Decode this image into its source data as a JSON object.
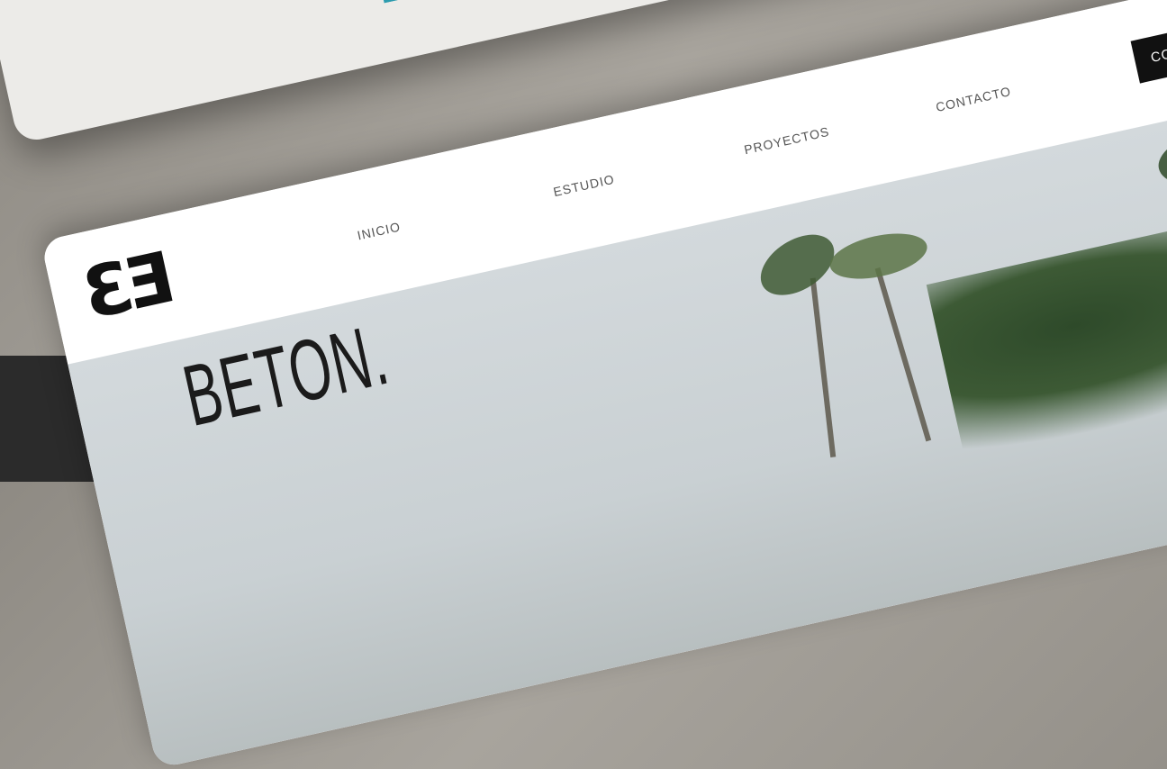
{
  "nav": {
    "logo_text": "ƐƎ",
    "links": [
      "INICIO",
      "ESTUDIO",
      "PROYECTOS",
      "CONTACTO"
    ],
    "cta_label": "CON"
  },
  "hero": {
    "title": "BETON."
  },
  "colors": {
    "background": "#9a968f",
    "card": "#ffffff",
    "cta": "#111111",
    "sky": "#d3d9dc"
  }
}
